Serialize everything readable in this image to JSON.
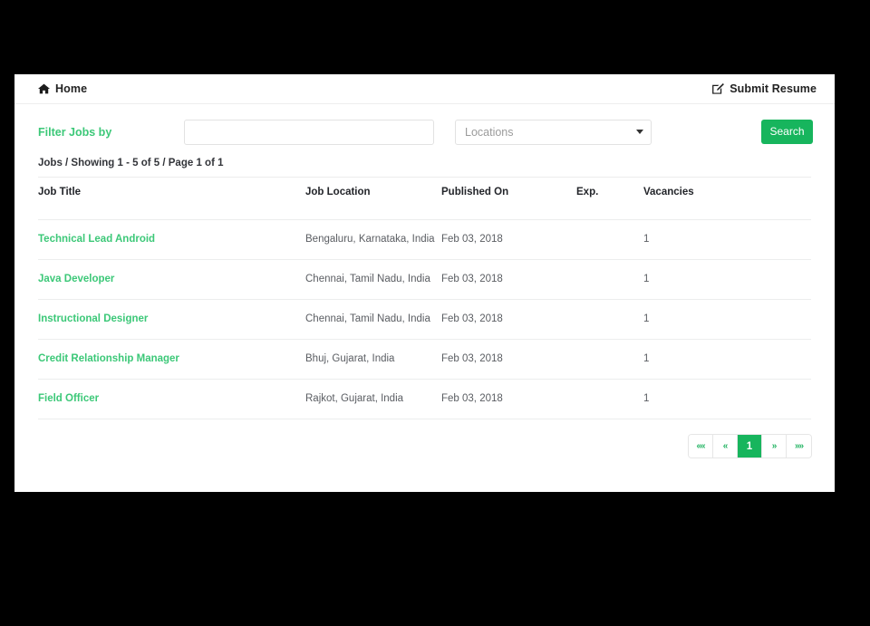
{
  "topbar": {
    "home_label": "Home",
    "home_icon": "home-icon",
    "submit_resume_label": "Submit Resume",
    "submit_resume_icon": "pencil-square-icon"
  },
  "filter": {
    "label": "Filter Jobs by",
    "keyword_value": "",
    "keyword_placeholder": "",
    "location_selected": "Locations",
    "location_caret_icon": "chevron-down-icon",
    "search_button": "Search"
  },
  "results": {
    "summary": "Jobs / Showing 1 - 5 of 5 / Page 1 of 1",
    "columns": [
      "Job Title",
      "Job Location",
      "Published On",
      "Exp.",
      "Vacancies"
    ],
    "rows": [
      {
        "title": "Technical Lead Android",
        "location": "Bengaluru, Karnataka, India",
        "published": "Feb 03, 2018",
        "exp": "",
        "vacancies": "1"
      },
      {
        "title": "Java Developer",
        "location": "Chennai, Tamil Nadu, India",
        "published": "Feb 03, 2018",
        "exp": "",
        "vacancies": "1"
      },
      {
        "title": "Instructional Designer",
        "location": "Chennai, Tamil Nadu, India",
        "published": "Feb 03, 2018",
        "exp": "",
        "vacancies": "1"
      },
      {
        "title": "Credit Relationship Manager",
        "location": "Bhuj, Gujarat, India",
        "published": "Feb 03, 2018",
        "exp": "",
        "vacancies": "1"
      },
      {
        "title": "Field Officer",
        "location": "Rajkot, Gujarat, India",
        "published": "Feb 03, 2018",
        "exp": "",
        "vacancies": "1"
      }
    ]
  },
  "pagination": {
    "first_label": "««",
    "prev_label": "«",
    "pages": [
      "1"
    ],
    "active_page": "1",
    "next_label": "»",
    "last_label": "»»"
  },
  "colors": {
    "accent_green": "#17b55d",
    "link_green": "#3cc878",
    "page_background": "#000000",
    "panel_background": "#ffffff",
    "border_gray": "#eceded"
  }
}
